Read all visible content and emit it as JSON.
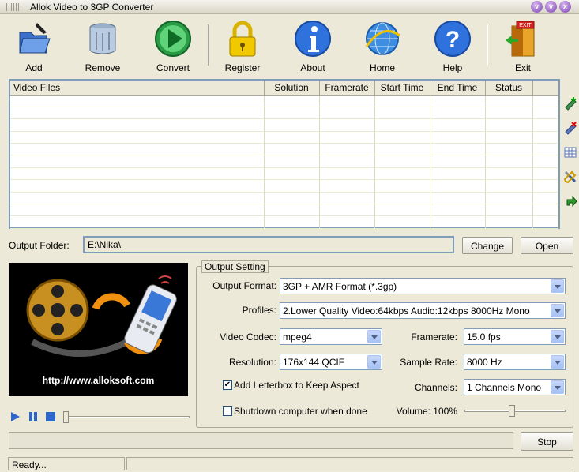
{
  "app": {
    "title": "Allok Video to 3GP Converter"
  },
  "toolbar": {
    "add": "Add",
    "remove": "Remove",
    "convert": "Convert",
    "register": "Register",
    "about": "About",
    "home": "Home",
    "help": "Help",
    "exit": "Exit"
  },
  "filelist": {
    "columns": [
      "Video Files",
      "Solution",
      "Framerate",
      "Start Time",
      "End Time",
      "Status"
    ],
    "rows": []
  },
  "output": {
    "label": "Output Folder:",
    "path": "E:\\Nika\\",
    "change": "Change",
    "open": "Open"
  },
  "preview": {
    "url": "http://www.alloksoft.com"
  },
  "settings": {
    "legend": "Output Setting",
    "output_format_label": "Output Format:",
    "output_format": "3GP + AMR Format (*.3gp)",
    "profiles_label": "Profiles:",
    "profile": "2.Lower  Quality Video:64kbps  Audio:12kbps 8000Hz Mono",
    "video_codec_label": "Video Codec:",
    "video_codec": "mpeg4",
    "framerate_label": "Framerate:",
    "framerate": "15.0   fps",
    "resolution_label": "Resolution:",
    "resolution": "176x144 QCIF",
    "sample_rate_label": "Sample Rate:",
    "sample_rate": "8000  Hz",
    "letterbox_label": "Add Letterbox to Keep Aspect",
    "letterbox_checked": true,
    "channels_label": "Channels:",
    "channels": "1 Channels Mono",
    "shutdown_label": "Shutdown computer when done",
    "shutdown_checked": false,
    "volume_label": "Volume: 100%",
    "volume": 1.0
  },
  "actions": {
    "stop": "Stop"
  },
  "status": {
    "text": "Ready..."
  }
}
